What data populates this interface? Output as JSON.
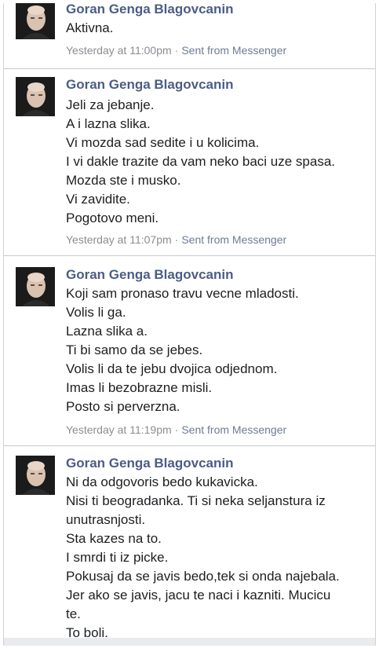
{
  "messages": [
    {
      "sender": "Goran Genga Blagovcanin",
      "lines": [
        "Aktivna."
      ],
      "time": "Yesterday at 11:00pm",
      "source": "Sent from Messenger"
    },
    {
      "sender": "Goran Genga Blagovcanin",
      "lines": [
        "Jeli za jebanje.",
        "A i lazna slika.",
        "Vi mozda sad sedite i u kolicima.",
        "I vi dakle trazite da vam neko baci uze spasa.",
        "Mozda ste i musko.",
        "Vi zavidite.",
        "Pogotovo meni."
      ],
      "time": "Yesterday at 11:07pm",
      "source": "Sent from Messenger"
    },
    {
      "sender": "Goran Genga Blagovcanin",
      "lines": [
        "Koji sam pronaso travu vecne mladosti.",
        "Volis li ga.",
        "Lazna slika a.",
        "Ti bi samo da se jebes.",
        "Volis li da te jebu dvojica odjednom.",
        "Imas li bezobrazne misli.",
        "Posto si perverzna."
      ],
      "time": "Yesterday at 11:19pm",
      "source": "Sent from Messenger"
    },
    {
      "sender": "Goran Genga Blagovcanin",
      "lines": [
        "Ni da odgovoris bedo kukavicka.",
        "Nisi ti beogradanka. Ti si neka seljanstura iz",
        "unutrasnjosti.",
        "Sta kazes na to.",
        "I smrdi ti iz picke.",
        "Pokusaj da se javis bedo,tek si onda najebala.",
        "Jer ako se javis, jacu te naci i kazniti. Mucicu",
        "te.",
        "To boli."
      ],
      "time": "",
      "source": ""
    }
  ],
  "separator": "·"
}
